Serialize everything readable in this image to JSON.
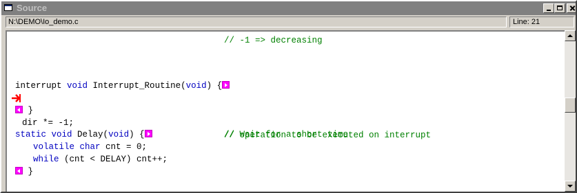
{
  "window": {
    "title": "Source"
  },
  "info": {
    "path": "N:\\DEMO\\Io_demo.c",
    "line": "Line: 21"
  },
  "code": {
    "line_comment_decreasing": "// -1 => decreasing",
    "isr_kw_interrupt": "interrupt",
    "isr_kw_void": "void",
    "isr_name": " Interrupt_Routine(",
    "isr_param_void": "void",
    "isr_close": ") {",
    "exec_stmt": "dir *= -1;",
    "exec_comment": "// operation to be executed on interrupt",
    "close_brace": "}",
    "delay_kw_static": "static",
    "delay_kw_void": "void",
    "delay_name": " Delay(",
    "delay_param_void": "void",
    "delay_close": ") {",
    "delay_comment": "// Wait for a short time",
    "cnt_kw_volatile": "volatile",
    "cnt_kw_char": "char",
    "cnt_rest": " cnt = 0;",
    "while_kw": "while",
    "while_rest": " (cnt < DELAY) cnt++;",
    "close_brace_2": "}"
  },
  "colors": {
    "keyword": "#0000c0",
    "comment": "#008000",
    "marker": "#ff00ff",
    "exec_arrow": "#ff0000"
  },
  "icons": [
    "window-icon",
    "minimize-icon",
    "maximize-icon",
    "close-icon",
    "collapse-marker-icon",
    "expand-marker-icon",
    "execution-arrow-icon",
    "scroll-up-icon",
    "scroll-down-icon"
  ]
}
